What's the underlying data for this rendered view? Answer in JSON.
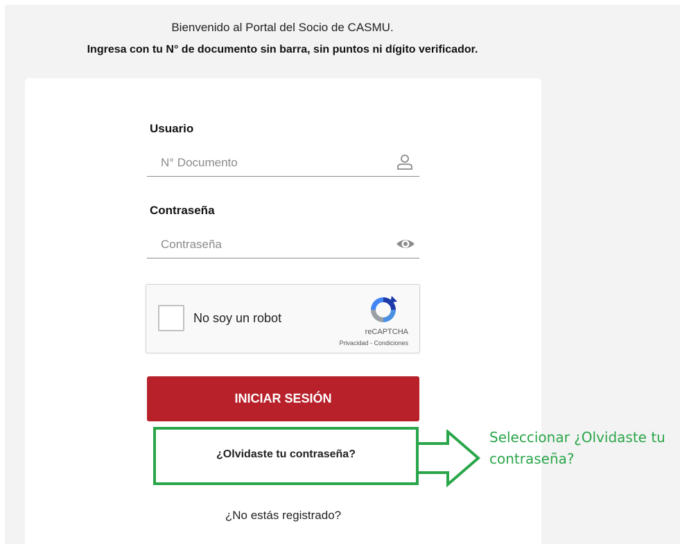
{
  "header": {
    "welcome": "Bienvenido al Portal del Socio de CASMU.",
    "instruction": "Ingresa con tu N° de documento sin barra, sin puntos ni dígito verificador."
  },
  "form": {
    "user_label": "Usuario",
    "user_placeholder": "N° Documento",
    "user_icon": "user-icon",
    "password_label": "Contraseña",
    "password_placeholder": "Contraseña",
    "password_icon": "eye-icon",
    "captcha": {
      "label": "No soy un robot",
      "brand": "reCAPTCHA",
      "links": "Privacidad - Condiciones",
      "icon": "recaptcha-icon"
    },
    "login_button": "INICIAR SESIÓN",
    "forgot_link": "¿Olvidaste tu contraseña?",
    "register_link": "¿No estás registrado?"
  },
  "annotation": {
    "line1": "Seleccionar ¿Olvidaste tu",
    "line2": "contraseña?",
    "color": "#2aa64a"
  },
  "colors": {
    "primary_button": "#b8202a",
    "page_background": "#f3f3f3"
  }
}
